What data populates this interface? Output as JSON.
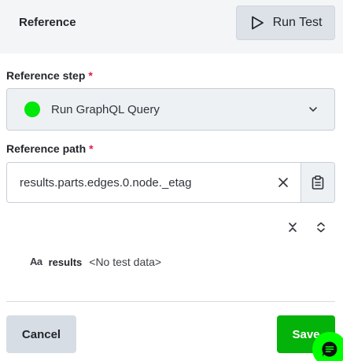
{
  "header": {
    "title": "Reference",
    "run_test_label": "Run Test"
  },
  "reference_step": {
    "label": "Reference step",
    "required_mark": "*",
    "selected_value": "Run GraphQL Query",
    "status_color": "#00e70a"
  },
  "reference_path": {
    "label": "Reference path",
    "required_mark": "*",
    "value": "results.parts.edges.0.node._etag"
  },
  "result": {
    "type_icon": "Aa",
    "key": "results",
    "value": "<No test data>"
  },
  "footer": {
    "cancel_label": "Cancel",
    "save_label": "Save"
  },
  "icons": {
    "run": "play-icon",
    "chevron": "chevron-down-icon",
    "clear": "close-icon",
    "clipboard": "clipboard-icon",
    "collapse": "collapse-all-icon",
    "expand": "expand-all-icon",
    "type": "text-type-icon",
    "chat": "chat-icon"
  },
  "colors": {
    "save": "#04b309",
    "required": "#e11d48",
    "chat_fab": "#00ff00"
  }
}
